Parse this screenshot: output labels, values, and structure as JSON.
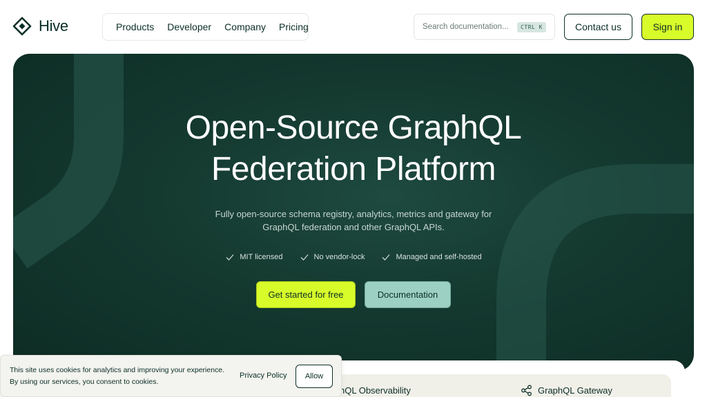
{
  "brand": {
    "name": "Hive",
    "logo_icon": "hive-logo-icon"
  },
  "nav": {
    "items": [
      "Products",
      "Developer",
      "Company",
      "Pricing"
    ]
  },
  "search": {
    "placeholder": "Search documentation...",
    "shortcut": "CTRL K",
    "icon": "search-icon"
  },
  "header_actions": {
    "contact": "Contact us",
    "signin": "Sign in"
  },
  "hero": {
    "title_line1": "Open-Source GraphQL",
    "title_line2": "Federation Platform",
    "subtitle_line1": "Fully open-source schema registry, analytics, metrics and gateway for",
    "subtitle_line2": "GraphQL federation and other GraphQL APIs.",
    "features": [
      "MIT licensed",
      "No vendor-lock",
      "Managed and self-hosted"
    ],
    "cta_primary": "Get started for free",
    "cta_secondary": "Documentation"
  },
  "products": {
    "item1": "hQL Observability",
    "item2": "GraphQL Gateway",
    "item2_icon": "share-nodes-icon"
  },
  "cookie": {
    "line1": "This site uses cookies for analytics and improving your experience.",
    "line2": "By using our services, you consent to cookies.",
    "privacy": "Privacy Policy",
    "allow": "Allow"
  },
  "colors": {
    "accent": "#d8fc2a",
    "hero_bg": "#14392f",
    "secondary_btn": "#9cd0c2",
    "text": "#0b2e26"
  }
}
